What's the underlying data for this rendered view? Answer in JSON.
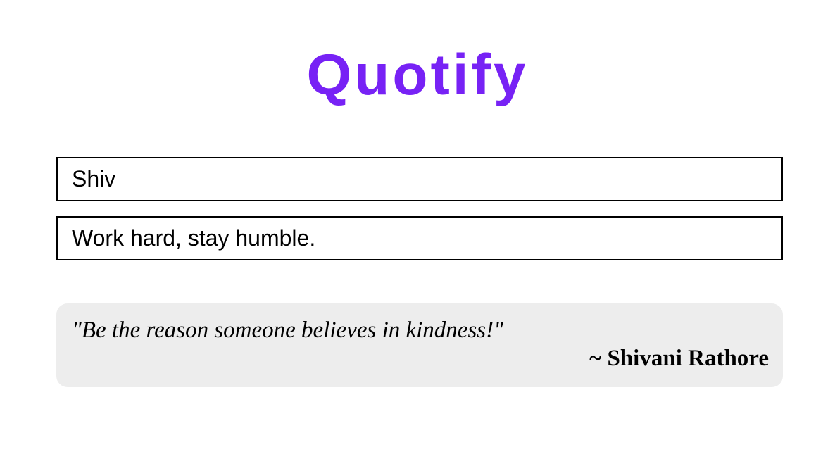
{
  "app": {
    "title": "Quotify",
    "accent": "#7722f5"
  },
  "form": {
    "author_value": "Shiv",
    "quote_value": "Work hard, stay humble."
  },
  "quote_card": {
    "text": "\"Be the reason someone believes in kindness!\"",
    "author": "~ Shivani Rathore"
  }
}
